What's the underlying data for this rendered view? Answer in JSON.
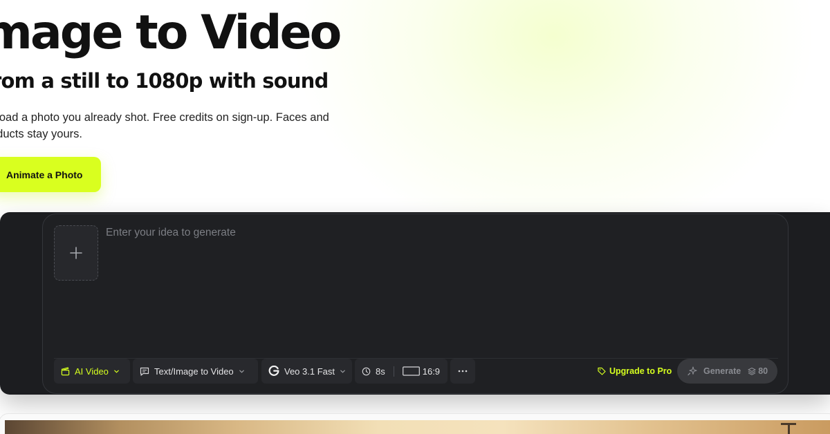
{
  "hero": {
    "title": "mage to Video",
    "subtitle": "rom a still to 1080p with sound",
    "description": "pload a photo you already shot. Free credits on sign-up. Faces and oducts stay yours.",
    "cta_label": "Animate a Photo"
  },
  "generator": {
    "prompt_placeholder": "Enter your idea to generate",
    "upload_icon": "plus-icon",
    "toolbar": {
      "category_label": "AI Video",
      "category_icon": "clapperboard-icon",
      "mode_label": "Text/Image to Video",
      "mode_icon": "chat-icon",
      "model_label": "Veo 3.1 Fast",
      "model_icon": "google-g-icon",
      "duration_label": "8s",
      "aspect_label": "16:9",
      "more_icon": "more-horizontal-icon",
      "upgrade_label": "Upgrade to Pro",
      "generate_label": "Generate",
      "generate_credits": "80"
    }
  },
  "colors": {
    "accent": "#d9ff1f",
    "panel_bg": "#1f2023",
    "text_dark": "#111111"
  }
}
